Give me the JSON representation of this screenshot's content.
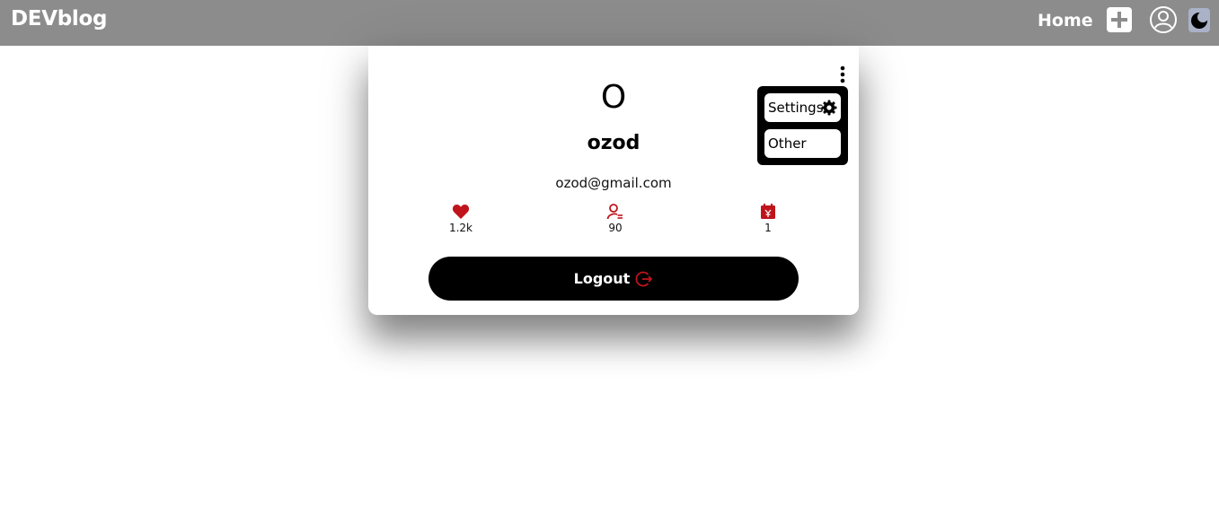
{
  "navbar": {
    "brand": "DEVblog",
    "home_label": "Home",
    "icons": [
      "plus-icon",
      "user-circle-icon",
      "moon-icon"
    ]
  },
  "profile": {
    "avatar_letter": "O",
    "username": "ozod",
    "email": "ozod@gmail.com",
    "stats": [
      {
        "icon": "heart-icon",
        "value": "1.2k"
      },
      {
        "icon": "followers-icon",
        "value": "90"
      },
      {
        "icon": "calendar-icon",
        "value": "1"
      }
    ],
    "logout_label": "Logout"
  },
  "menu": {
    "items": [
      {
        "label": "Settings",
        "icon": "gear-icon"
      },
      {
        "label": "Other"
      }
    ]
  },
  "colors": {
    "navbar_bg": "#8c8c8c",
    "accent_red": "#c0141c",
    "button_bg": "#000000"
  }
}
